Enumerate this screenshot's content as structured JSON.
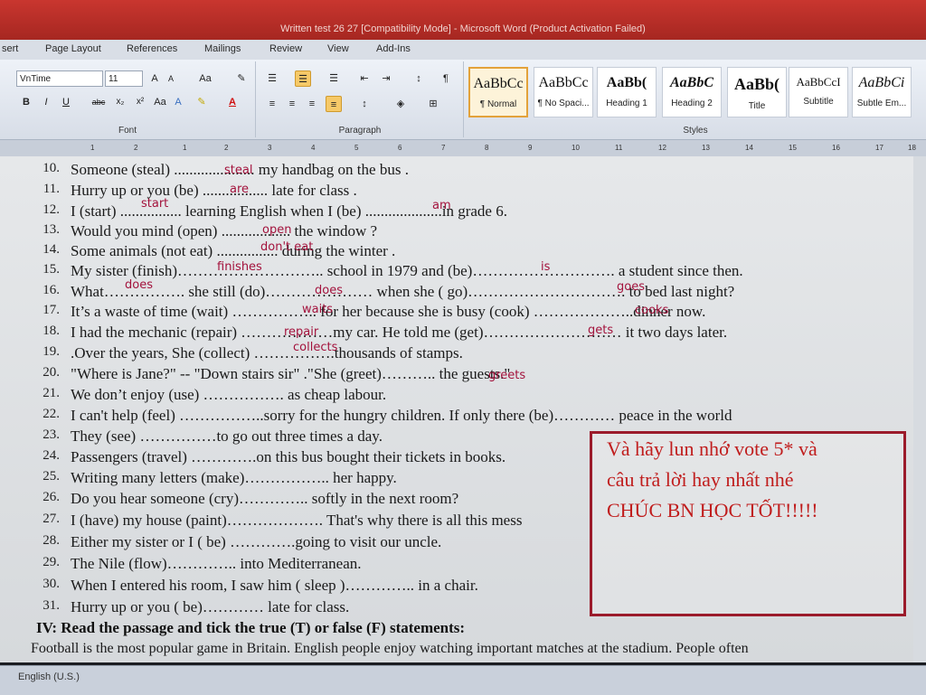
{
  "window": {
    "title": "Written test 26 27 [Compatibility Mode] - Microsoft Word (Product Activation Failed)"
  },
  "ribbon_tabs": [
    "sert",
    "Page Layout",
    "References",
    "Mailings",
    "Review",
    "View",
    "Add-Ins"
  ],
  "font": {
    "name": "VnTime",
    "size": "11",
    "group_label": "Font"
  },
  "paragraph": {
    "group_label": "Paragraph"
  },
  "styles": {
    "group_label": "Styles",
    "items": [
      {
        "sample": "AaBbCc",
        "name": "¶ Normal"
      },
      {
        "sample": "AaBbCc",
        "name": "¶ No Spaci..."
      },
      {
        "sample": "AaBb(",
        "name": "Heading 1"
      },
      {
        "sample": "AaBbC",
        "name": "Heading 2"
      },
      {
        "sample": "AaBb(",
        "name": "Title"
      },
      {
        "sample": "AaBbCcI",
        "name": "Subtitle"
      },
      {
        "sample": "AaBbCi",
        "name": "Subtle Em..."
      }
    ]
  },
  "ruler_ticks": [
    "1",
    "2",
    "1",
    "2",
    "3",
    "4",
    "5",
    "6",
    "7",
    "8",
    "9",
    "10",
    "11",
    "12",
    "13",
    "14",
    "15",
    "16",
    "17",
    "18"
  ],
  "exercise": {
    "lines": [
      {
        "num": "10.",
        "text": "Someone (steal) ..................... my handbag on the bus ."
      },
      {
        "num": "11.",
        "text": "Hurry up or you (be) ................. late for class ."
      },
      {
        "num": "12.",
        "text": "I (start) ................ learning English when I (be) ....................in grade 6."
      },
      {
        "num": "13.",
        "text": "Would you mind (open) .................. the window ?"
      },
      {
        "num": "14.",
        "text": "Some animals (not eat) ................ during the winter ."
      },
      {
        "num": "15.",
        "text": "My sister (finish)……………………….. school in 1979 and (be)………………………. a student since then."
      },
      {
        "num": "16.",
        "text": "What……………. she still (do)………………… when she ( go)…………………………. to bed last night?"
      },
      {
        "num": "17.",
        "text": "It’s a waste of time (wait) …………….. for her because she is busy (cook) ………………..dinner now."
      },
      {
        "num": "18.",
        "text": "I had the mechanic (repair) ………………my car. He told me (get)……………………… it two days later."
      },
      {
        "num": "19.",
        "text": ".Over the years, She (collect) …………….thousands of stamps."
      },
      {
        "num": "20.",
        "text": "\"Where is Jane?\"        -- \"Down stairs sir\" .\"She (greet)……….. the guests.\""
      },
      {
        "num": "21.",
        "text": "We don’t enjoy (use) ……………. as cheap labour."
      },
      {
        "num": "22.",
        "text": "I can't help (feel) ……………..sorry for the hungry children. If only there (be)………… peace in the world"
      },
      {
        "num": "23.",
        "text": "They (see) ……………to go out three times a day."
      },
      {
        "num": "24.",
        "text": "Passengers (travel) ………….on this bus bought their tickets in books."
      },
      {
        "num": "25.",
        "text": "Writing many letters (make)…………….. her happy."
      },
      {
        "num": "26.",
        "text": "Do you hear someone (cry)………….. softly in the next room?"
      },
      {
        "num": "27.",
        "text": "I (have) my house (paint)………………. That's why there is all this mess"
      },
      {
        "num": "28.",
        "text": "Either my sister or I ( be) ………….going to visit our uncle."
      },
      {
        "num": "29.",
        "text": "The Nile (flow)………….. into Mediterranean."
      },
      {
        "num": "30.",
        "text": "When I entered his room, I saw him ( sleep )………….. in a chair."
      },
      {
        "num": "31.",
        "text": "Hurry up or you ( be)………… late for class."
      }
    ],
    "answers": [
      {
        "text": "steal",
        "line": "10"
      },
      {
        "text": "are",
        "line": "11"
      },
      {
        "text": "start",
        "line": "12"
      },
      {
        "text": "am",
        "line": "12"
      },
      {
        "text": "open",
        "line": "13"
      },
      {
        "text": "don't eat",
        "line": "14"
      },
      {
        "text": "finishes",
        "line": "15"
      },
      {
        "text": "is",
        "line": "15"
      },
      {
        "text": "does",
        "line": "16"
      },
      {
        "text": "does",
        "line": "16"
      },
      {
        "text": "goes",
        "line": "16"
      },
      {
        "text": "waits",
        "line": "17"
      },
      {
        "text": "cooks",
        "line": "17"
      },
      {
        "text": "repair",
        "line": "18"
      },
      {
        "text": "gets",
        "line": "18"
      },
      {
        "text": "collects",
        "line": "19"
      },
      {
        "text": "greets",
        "line": "20"
      }
    ],
    "section_heading": "IV: Read the passage and tick the true (T) or false (F) statements:",
    "passage_line": "Football is the most popular game in Britain. English people enjoy watching important matches at the stadium. People often"
  },
  "note": {
    "lines": [
      "Và hãy lun nhớ vote 5* và",
      "câu trả lời hay nhất nhé",
      "CHÚC BN HỌC TỐT!!!!!"
    ],
    "color": "#c01d1d"
  },
  "status": {
    "language": "English (U.S.)"
  }
}
